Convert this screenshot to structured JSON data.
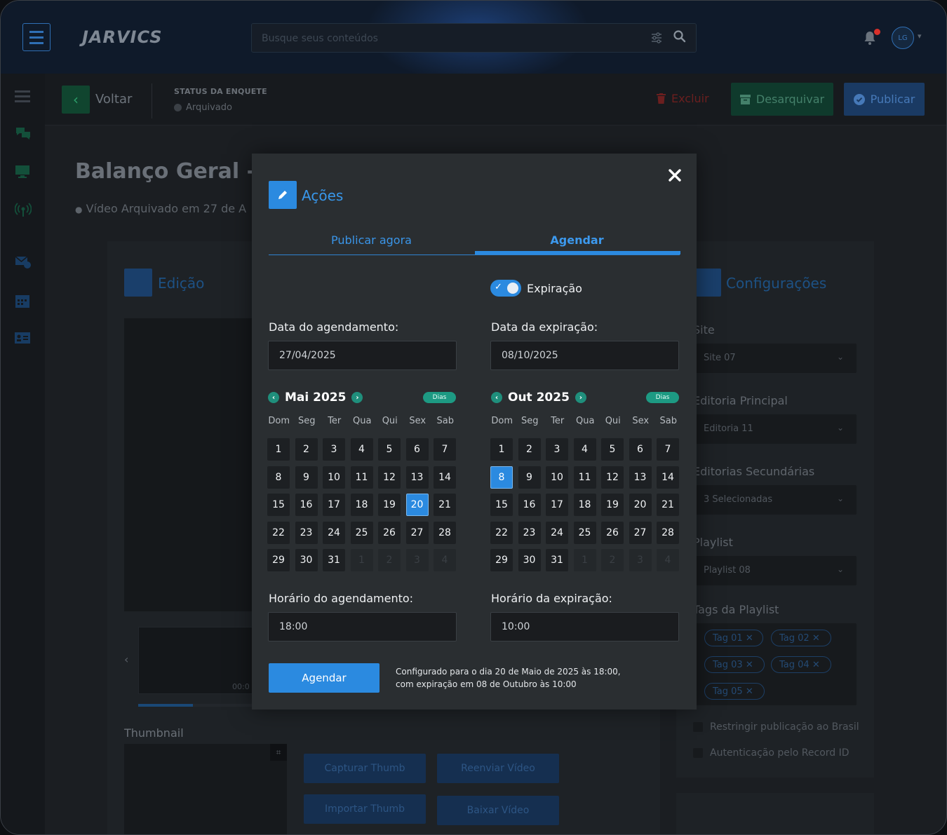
{
  "header": {
    "logo": "JARVICS",
    "search_placeholder": "Busque seus conteúdos",
    "avatar_initials": "LG",
    "colors": {
      "brand": "#2b8ae0",
      "bg": "#0f1a2a"
    }
  },
  "subheader": {
    "back_label": "Voltar",
    "status_title": "STATUS DA ENQUETE",
    "status_value": "Arquivado",
    "delete_label": "Excluir",
    "unarchive_label": "Desarquivar",
    "publish_label": "Publicar"
  },
  "page": {
    "title": "Balanço Geral - I",
    "subtitle": "Vídeo Arquivado em 27 de A"
  },
  "edit_panel": {
    "title": "Edição",
    "player_time": "00:0",
    "thumbnail_label": "Thumbnail",
    "buttons": [
      "Capturar Thumb",
      "Reenviar Vídeo",
      "Importar Thumb",
      "Baixar Vídeo"
    ]
  },
  "config_panel": {
    "title": "Configurações",
    "site_label": "Site",
    "site_value": "Site 07",
    "editoria_label": "Editoria Principal",
    "editoria_value": "Editoria 11",
    "sec_label": "Editorias Secundárias",
    "sec_value": "3 Selecionadas",
    "playlist_label": "Playlist",
    "playlist_value": "Playlist 08",
    "tags_label": "Tags da Playlist",
    "tags": [
      "Tag 01",
      "Tag 02",
      "Tag 03",
      "Tag 04",
      "Tag 05"
    ],
    "check1": "Restringir publicação ao Brasil",
    "check2": "Autenticação pelo Record ID"
  },
  "modal": {
    "title": "Ações",
    "tabs": [
      "Publicar agora",
      "Agendar"
    ],
    "active_tab": "Agendar",
    "toggle_label": "Expiração",
    "toggle_on": true,
    "schedule_date_label": "Data do agendamento:",
    "schedule_date_value": "27/04/2025",
    "expiry_date_label": "Data da expiração:",
    "expiry_date_value": "08/10/2025",
    "badge": "Dias",
    "weekdays": [
      "Dom",
      "Seg",
      "Ter",
      "Qua",
      "Qui",
      "Sex",
      "Sab"
    ],
    "cal_left": {
      "month": "Mai 2025",
      "selected": 20
    },
    "cal_right": {
      "month": "Out 2025",
      "selected": 8
    },
    "schedule_time_label": "Horário do agendamento:",
    "schedule_time_value": "18:00",
    "expiry_time_label": "Horário da expiração:",
    "expiry_time_value": "10:00",
    "submit_label": "Agendar",
    "note_line1": "Configurado para o dia 20 de Maio de 2025 às 18:00,",
    "note_line2": "com expiração em 08 de Outubro às 10:00"
  }
}
